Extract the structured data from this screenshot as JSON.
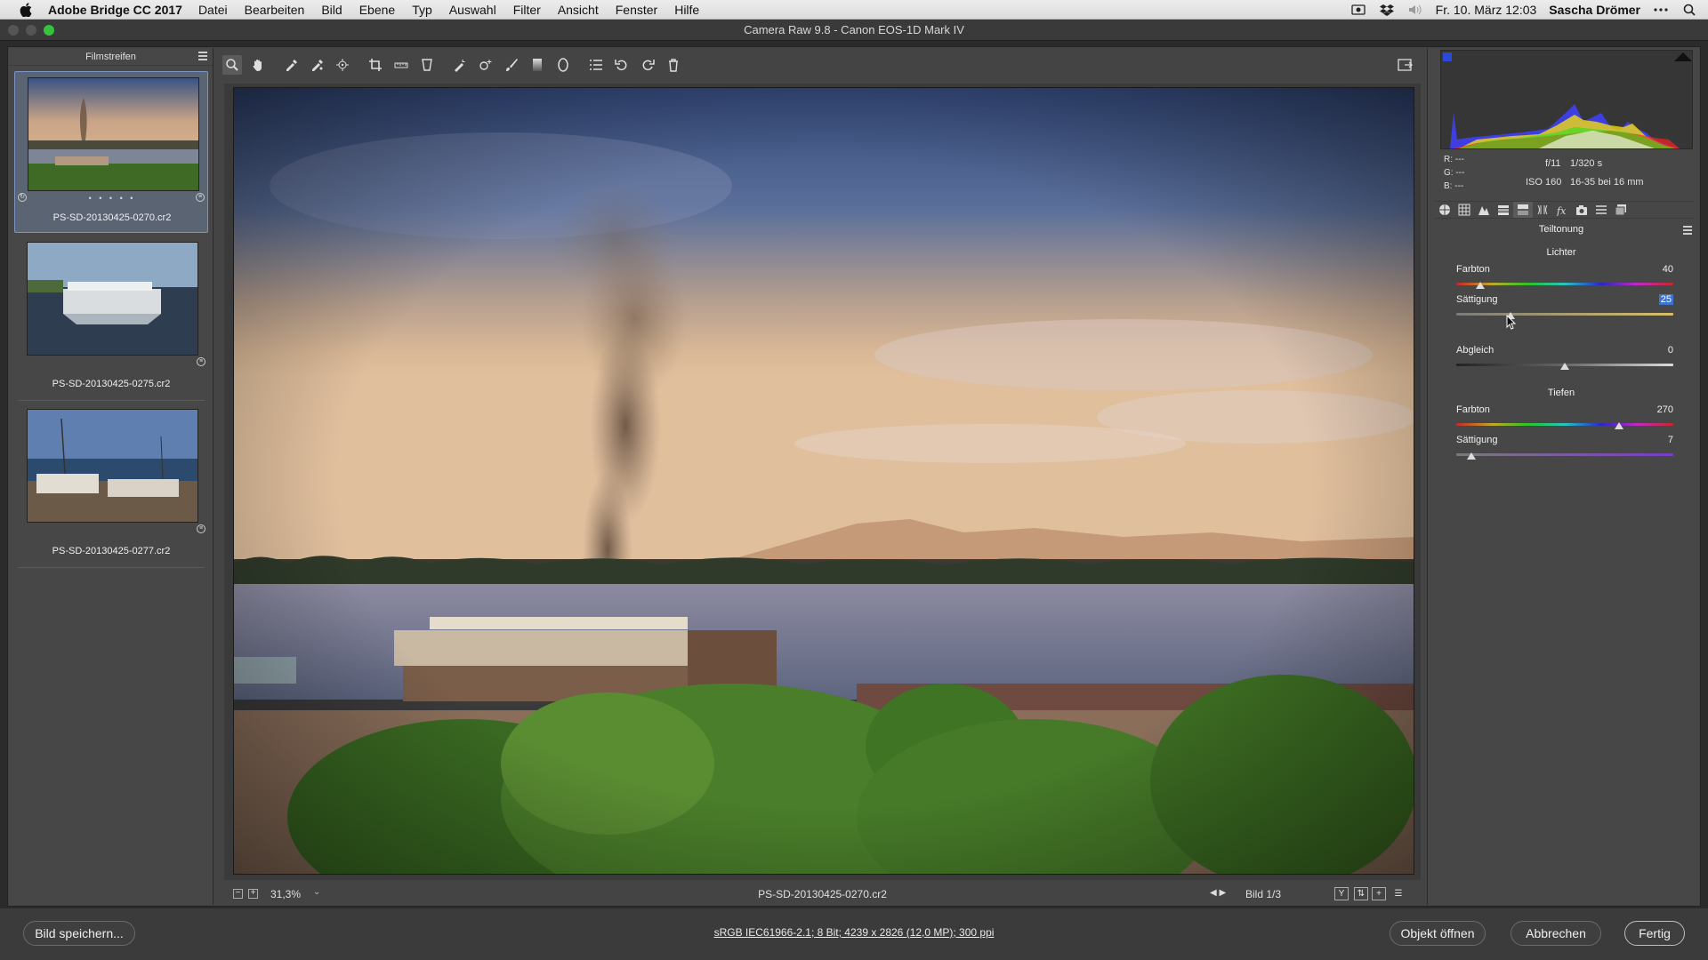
{
  "menubar": {
    "app_name": "Adobe Bridge CC 2017",
    "items": [
      "Datei",
      "Bearbeiten",
      "Bild",
      "Ebene",
      "Typ",
      "Auswahl",
      "Filter",
      "Ansicht",
      "Fenster",
      "Hilfe"
    ],
    "datetime": "Fr. 10. März 12:03",
    "user": "Sascha Drömer"
  },
  "window": {
    "title": "Camera Raw 9.8 - Canon EOS-1D Mark IV"
  },
  "filmstrip": {
    "title": "Filmstreifen",
    "items": [
      {
        "name": "PS-SD-20130425-0270.cr2",
        "rating": "• • • • •"
      },
      {
        "name": "PS-SD-20130425-0275.cr2"
      },
      {
        "name": "PS-SD-20130425-0277.cr2"
      }
    ]
  },
  "toolbar": {
    "tools": [
      "zoom-tool-icon",
      "hand-tool-icon",
      "white-balance-icon",
      "color-sampler-icon",
      "target-adjust-icon",
      "crop-icon",
      "straighten-icon",
      "transform-icon",
      "spot-removal-icon",
      "red-eye-icon",
      "adjustment-brush-icon",
      "graduated-filter-icon",
      "radial-filter-icon",
      "preferences-icon",
      "rotate-ccw-icon",
      "rotate-cw-icon",
      "trash-icon"
    ]
  },
  "status": {
    "zoom": "31,3%",
    "filename": "PS-SD-20130425-0270.cr2",
    "image_counter": "Bild 1/3"
  },
  "info": {
    "r_label": "R:",
    "g_label": "G:",
    "b_label": "B:",
    "r": "---",
    "g": "---",
    "b": "---",
    "aperture": "f/11",
    "shutter": "1/320 s",
    "iso": "ISO 160",
    "lens": "16-35 bei 16 mm"
  },
  "panel": {
    "title": "Teiltonung",
    "highlights_title": "Lichter",
    "shadows_title": "Tiefen",
    "sliders": [
      {
        "label": "Farbton",
        "value": "40",
        "level": 0.11
      },
      {
        "label": "Sättigung",
        "value": "25",
        "level": 0.25
      },
      {
        "label": "Abgleich",
        "value": "0",
        "level": 0.5
      },
      {
        "label": "Farbton",
        "value": "270",
        "level": 0.75
      },
      {
        "label": "Sättigung",
        "value": "7",
        "level": 0.07
      }
    ]
  },
  "bottom": {
    "save_label": "Bild speichern...",
    "meta": "sRGB IEC61966-2.1; 8 Bit; 4239 x 2826 (12,0 MP); 300 ppi",
    "open_label": "Objekt öffnen",
    "cancel_label": "Abbrechen",
    "done_label": "Fertig"
  }
}
